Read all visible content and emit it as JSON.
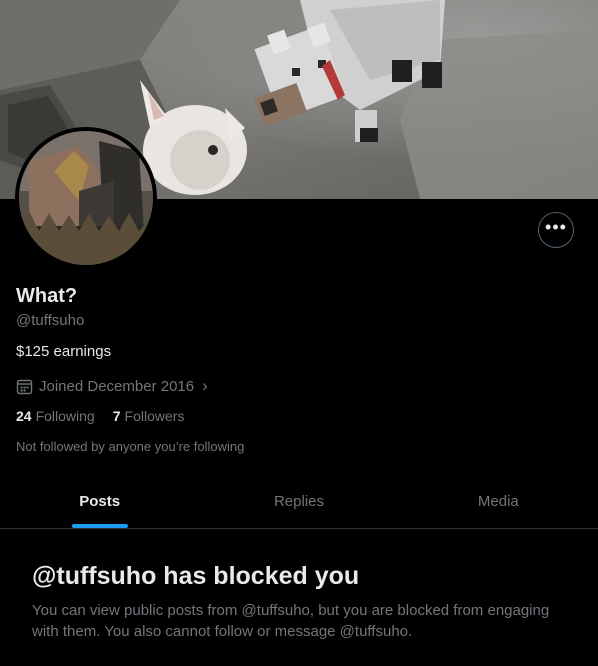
{
  "profile": {
    "display_name": "What?",
    "handle": "@tuffsuho",
    "bio": "$125 earnings",
    "joined": "Joined December 2016",
    "following_count": "24",
    "following_label": "Following",
    "followers_count": "7",
    "followers_label": "Followers",
    "not_followed_text": "Not followed by anyone you’re following"
  },
  "more_button": {
    "label": "•••"
  },
  "tabs": [
    {
      "label": "Posts",
      "active": true
    },
    {
      "label": "Replies",
      "active": false
    },
    {
      "label": "Media",
      "active": false
    }
  ],
  "blocked": {
    "title": "@tuffsuho has blocked you",
    "text": "You can view public posts from @tuffsuho, but you are blocked from engaging with them. You also cannot follow or message @tuffsuho."
  },
  "colors": {
    "background": "#000000",
    "primary_text": "#e7e9ea",
    "secondary_text": "#71767b",
    "accent": "#1d9bf0",
    "border": "#2f3336"
  }
}
